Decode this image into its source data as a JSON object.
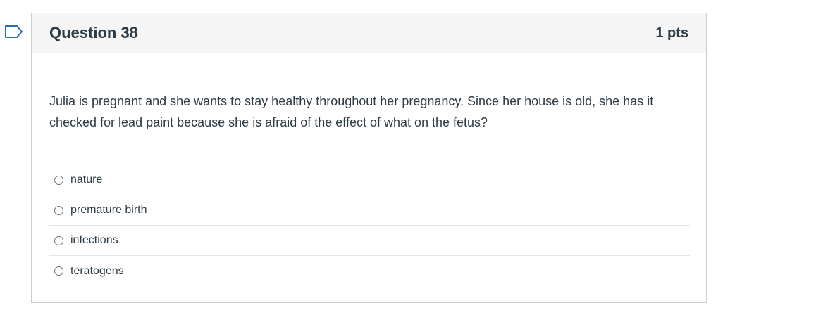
{
  "question": {
    "title": "Question 38",
    "points": "1 pts",
    "text": "Julia is pregnant and she wants to stay healthy throughout her pregnancy. Since her house is old, she has it checked for lead paint because she is afraid of the effect of what on the fetus?",
    "answers": [
      {
        "label": "nature"
      },
      {
        "label": "premature birth"
      },
      {
        "label": "infections"
      },
      {
        "label": "teratogens"
      }
    ]
  },
  "colors": {
    "flag": "#2b6cb0",
    "header_bg": "#f5f5f5",
    "border": "#c7cdd1",
    "text": "#2d3b45"
  },
  "icons": {
    "flag": "flag-outline-icon"
  }
}
